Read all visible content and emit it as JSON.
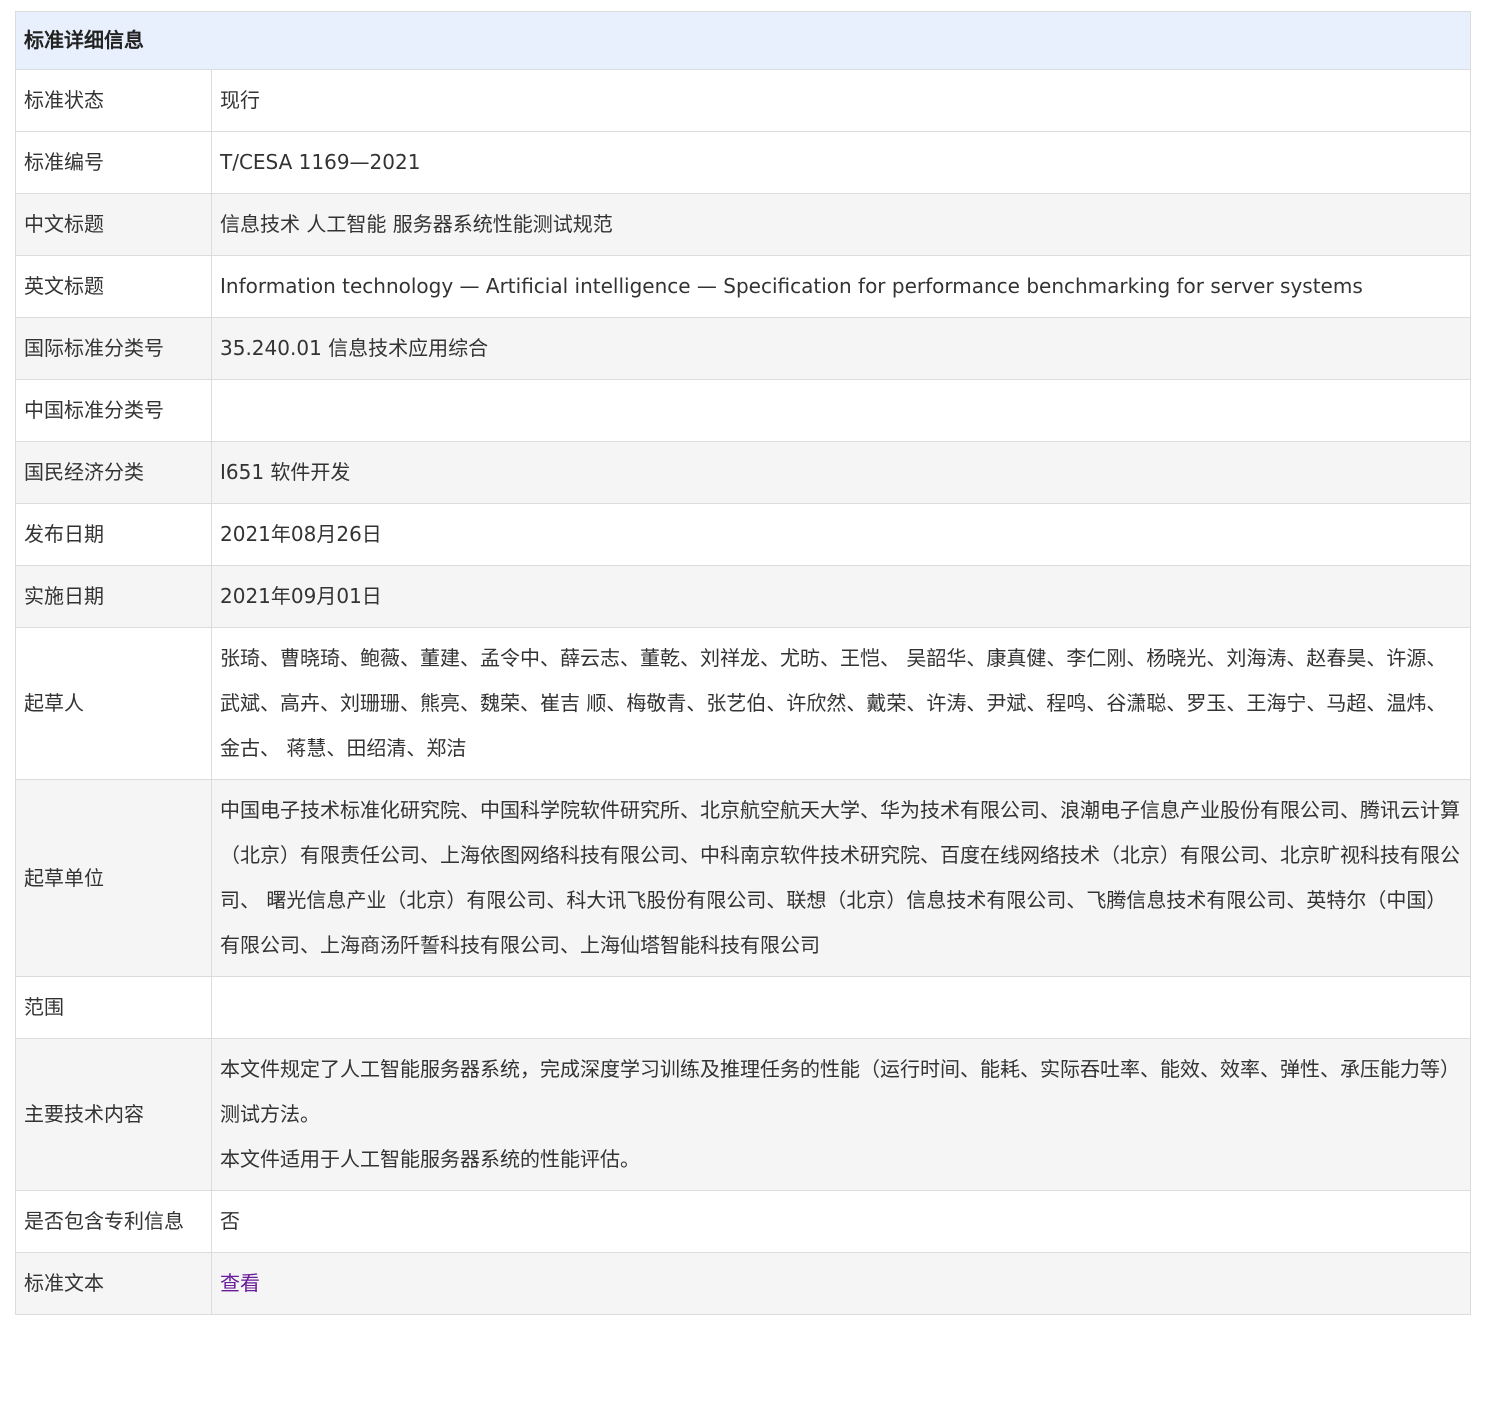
{
  "table": {
    "heading": "标准详细信息",
    "rows": [
      {
        "label": "标准状态",
        "value": "现行"
      },
      {
        "label": "标准编号",
        "value": "T/CESA 1169—2021"
      },
      {
        "label": "中文标题",
        "value": "信息技术 人工智能 服务器系统性能测试规范"
      },
      {
        "label": "英文标题",
        "value": "Information technology — Artificial intelligence — Specification for performance benchmarking for server systems"
      },
      {
        "label": "国际标准分类号",
        "value": "35.240.01 信息技术应用综合"
      },
      {
        "label": "中国标准分类号",
        "value": ""
      },
      {
        "label": "国民经济分类",
        "value": "I651 软件开发"
      },
      {
        "label": "发布日期",
        "value": "2021年08月26日"
      },
      {
        "label": "实施日期",
        "value": "2021年09月01日"
      },
      {
        "label": "起草人",
        "value": "张琦、曹晓琦、鲍薇、董建、孟令中、薛云志、董乾、刘祥龙、尤昉、王恺、 吴韶华、康真健、李仁刚、杨晓光、刘海涛、赵春昊、许源、武斌、高卉、刘珊珊、熊亮、魏荣、崔吉 顺、梅敬青、张艺伯、许欣然、戴荣、许涛、尹斌、程鸣、谷潇聪、罗玉、王海宁、马超、温炜、金古、 蒋慧、田绍清、郑洁"
      },
      {
        "label": "起草单位",
        "value": "中国电子技术标准化研究院、中国科学院软件研究所、北京航空航天大学、华为技术有限公司、浪潮电子信息产业股份有限公司、腾讯云计算（北京）有限责任公司、上海依图网络科技有限公司、中科南京软件技术研究院、百度在线网络技术（北京）有限公司、北京旷视科技有限公司、 曙光信息产业（北京）有限公司、科大讯飞股份有限公司、联想（北京）信息技术有限公司、飞腾信息技术有限公司、英特尔（中国）有限公司、上海商汤阡誓科技有限公司、上海仙塔智能科技有限公司"
      },
      {
        "label": "范围",
        "value": ""
      },
      {
        "label": "主要技术内容",
        "value_lines": [
          "本文件规定了人工智能服务器系统，完成深度学习训练及推理任务的性能（运行时间、能耗、实际吞吐率、能效、效率、弹性、承压能力等）测试方法。",
          "本文件适用于人工智能服务器系统的性能评估。"
        ]
      },
      {
        "label": "是否包含专利信息",
        "value": "否"
      },
      {
        "label": "标准文本",
        "link": "查看"
      }
    ]
  }
}
